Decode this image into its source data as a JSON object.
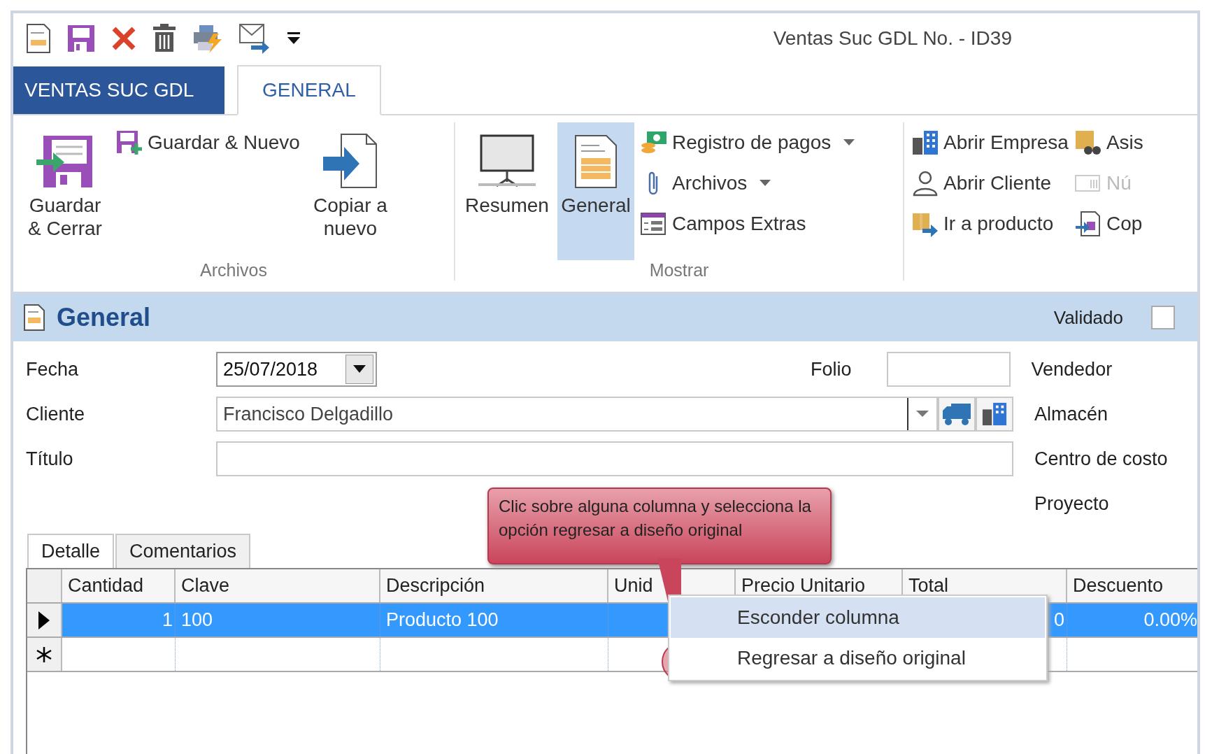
{
  "window": {
    "title": "Ventas Suc GDL No. - ID39"
  },
  "ribbon_tabs": [
    {
      "label": "VENTAS SUC GDL",
      "kind": "file",
      "selected": false
    },
    {
      "label": "GENERAL",
      "kind": "tab",
      "selected": true
    }
  ],
  "ribbon_groups": [
    {
      "label": "Archivos",
      "columns": [
        {
          "kind": "large",
          "items": [
            {
              "label": "Guardar & Cerrar",
              "selected": false
            }
          ]
        },
        {
          "kind": "small",
          "items": [
            {
              "label": "Guardar & Nuevo",
              "dropdown": false,
              "disabled": false
            }
          ]
        },
        {
          "kind": "large",
          "items": [
            {
              "label": "Copiar a nuevo",
              "selected": false
            }
          ]
        }
      ]
    },
    {
      "label": "Mostrar",
      "columns": [
        {
          "kind": "large",
          "items": [
            {
              "label": "Resumen",
              "selected": false
            }
          ]
        },
        {
          "kind": "large",
          "items": [
            {
              "label": "General",
              "selected": true
            }
          ]
        },
        {
          "kind": "small",
          "items": [
            {
              "label": "Registro de pagos",
              "dropdown": true,
              "disabled": false
            },
            {
              "label": "Archivos",
              "dropdown": true,
              "disabled": false
            },
            {
              "label": "Campos Extras",
              "dropdown": false,
              "disabled": false
            }
          ]
        }
      ]
    },
    {
      "columns": [
        {
          "kind": "small",
          "items": [
            {
              "label": "Abrir Empresa",
              "dropdown": false,
              "disabled": false
            },
            {
              "label": "Abrir Cliente",
              "dropdown": false,
              "disabled": false
            },
            {
              "label": "Ir a producto",
              "dropdown": false,
              "disabled": false
            }
          ]
        },
        {
          "kind": "small",
          "items": [
            {
              "label": "Asis",
              "dropdown": false,
              "disabled": false
            },
            {
              "label": "Nú",
              "dropdown": false,
              "disabled": true
            },
            {
              "label": "Cop",
              "dropdown": false,
              "disabled": false
            }
          ]
        }
      ]
    }
  ],
  "section": {
    "title": "General",
    "validated": {
      "label": "Validado",
      "checked": false
    }
  },
  "form": {
    "fecha": {
      "label": "Fecha",
      "value": "25/07/2018"
    },
    "folio": {
      "label": "Folio"
    },
    "cliente": {
      "label": "Cliente",
      "value": "Francisco Delgadillo"
    },
    "titulo": {
      "label": "Título"
    },
    "right_labels": [
      "Vendedor",
      "Almacén",
      "Centro de costo",
      "Proyecto"
    ]
  },
  "detail_tabs": [
    {
      "label": "Detalle",
      "selected": true
    },
    {
      "label": "Comentarios",
      "selected": false
    }
  ],
  "grid": {
    "columns": [
      "Cantidad",
      "Clave",
      "Descripción",
      "Unid",
      "Precio Unitario",
      "Total",
      "Descuento"
    ],
    "rows": [
      {
        "kind": "current",
        "selected": true,
        "cells": [
          "1",
          "100",
          "Producto 100",
          null,
          null,
          "0",
          "0.00%"
        ]
      },
      {
        "kind": "new",
        "selected": false,
        "cells": [
          null,
          null,
          null,
          null,
          null,
          null,
          null
        ]
      }
    ]
  },
  "callout": {
    "text": "Clic sobre alguna columna y selecciona la opción regresar a diseño original"
  },
  "context_menu": [
    {
      "label": "Esconder columna",
      "selected": true
    },
    {
      "label": "Regresar a diseño original",
      "selected": false
    }
  ]
}
